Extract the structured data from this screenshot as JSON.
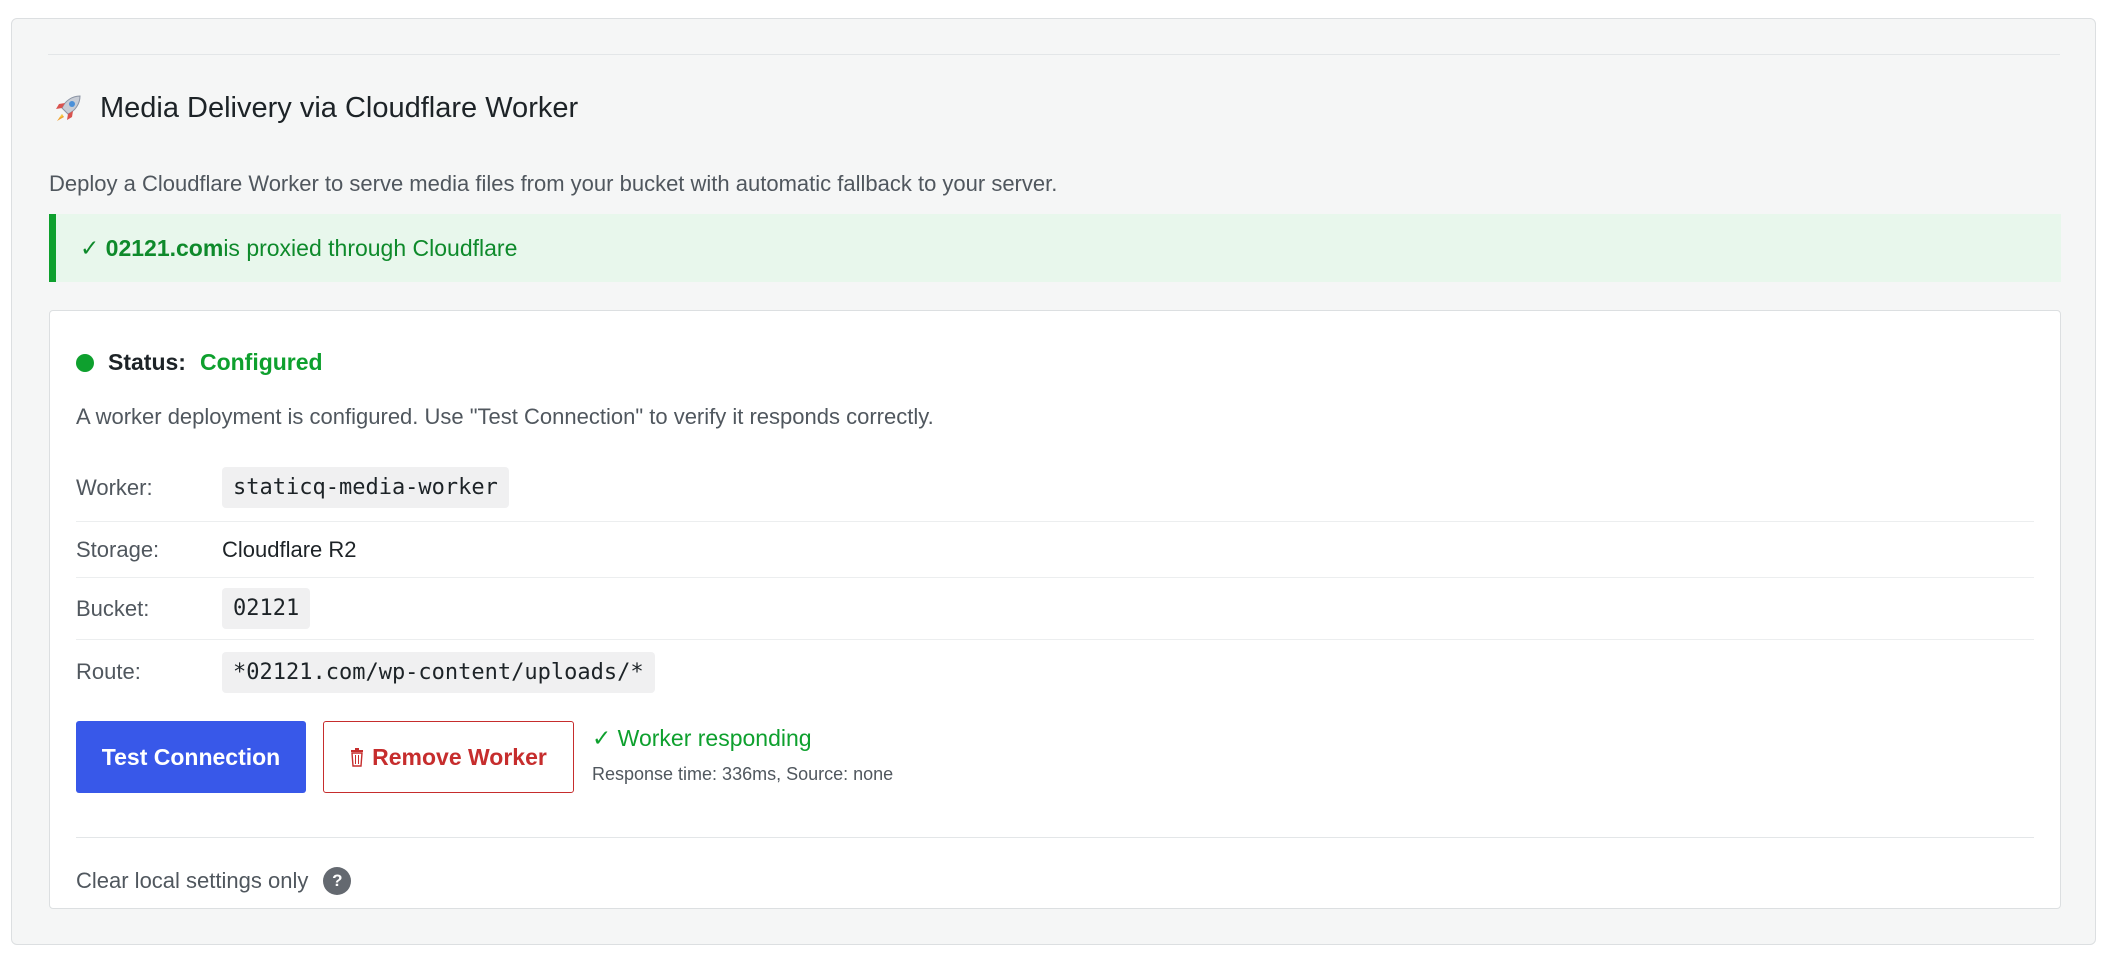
{
  "header": {
    "title": "Media Delivery via Cloudflare Worker",
    "icon": "rocket-icon",
    "description": "Deploy a Cloudflare Worker to serve media files from your bucket with automatic fallback to your server."
  },
  "notice": {
    "check": "✓",
    "domain": "02121.com",
    "text": " is proxied through Cloudflare"
  },
  "status": {
    "label": "Status:",
    "value": "Configured",
    "description": "A worker deployment is configured. Use \"Test Connection\" to verify it responds correctly."
  },
  "details": [
    {
      "label": "Worker:",
      "value": "staticq-media-worker"
    },
    {
      "label": "Storage:",
      "value": "Cloudflare R2"
    },
    {
      "label": "Bucket:",
      "value": "02121"
    },
    {
      "label": "Route:",
      "value": "*02121.com/wp-content/uploads/*"
    }
  ],
  "actions": {
    "test_label": "Test Connection",
    "remove_label": "Remove Worker"
  },
  "test_result": {
    "message": "✓ Worker responding",
    "meta": "Response time: 336ms, Source: none"
  },
  "clear_local": {
    "label": "Clear local settings only",
    "help": "?"
  },
  "colors": {
    "accent": "#3858e9",
    "success": "#0ea02e",
    "danger": "#c62d2d"
  }
}
